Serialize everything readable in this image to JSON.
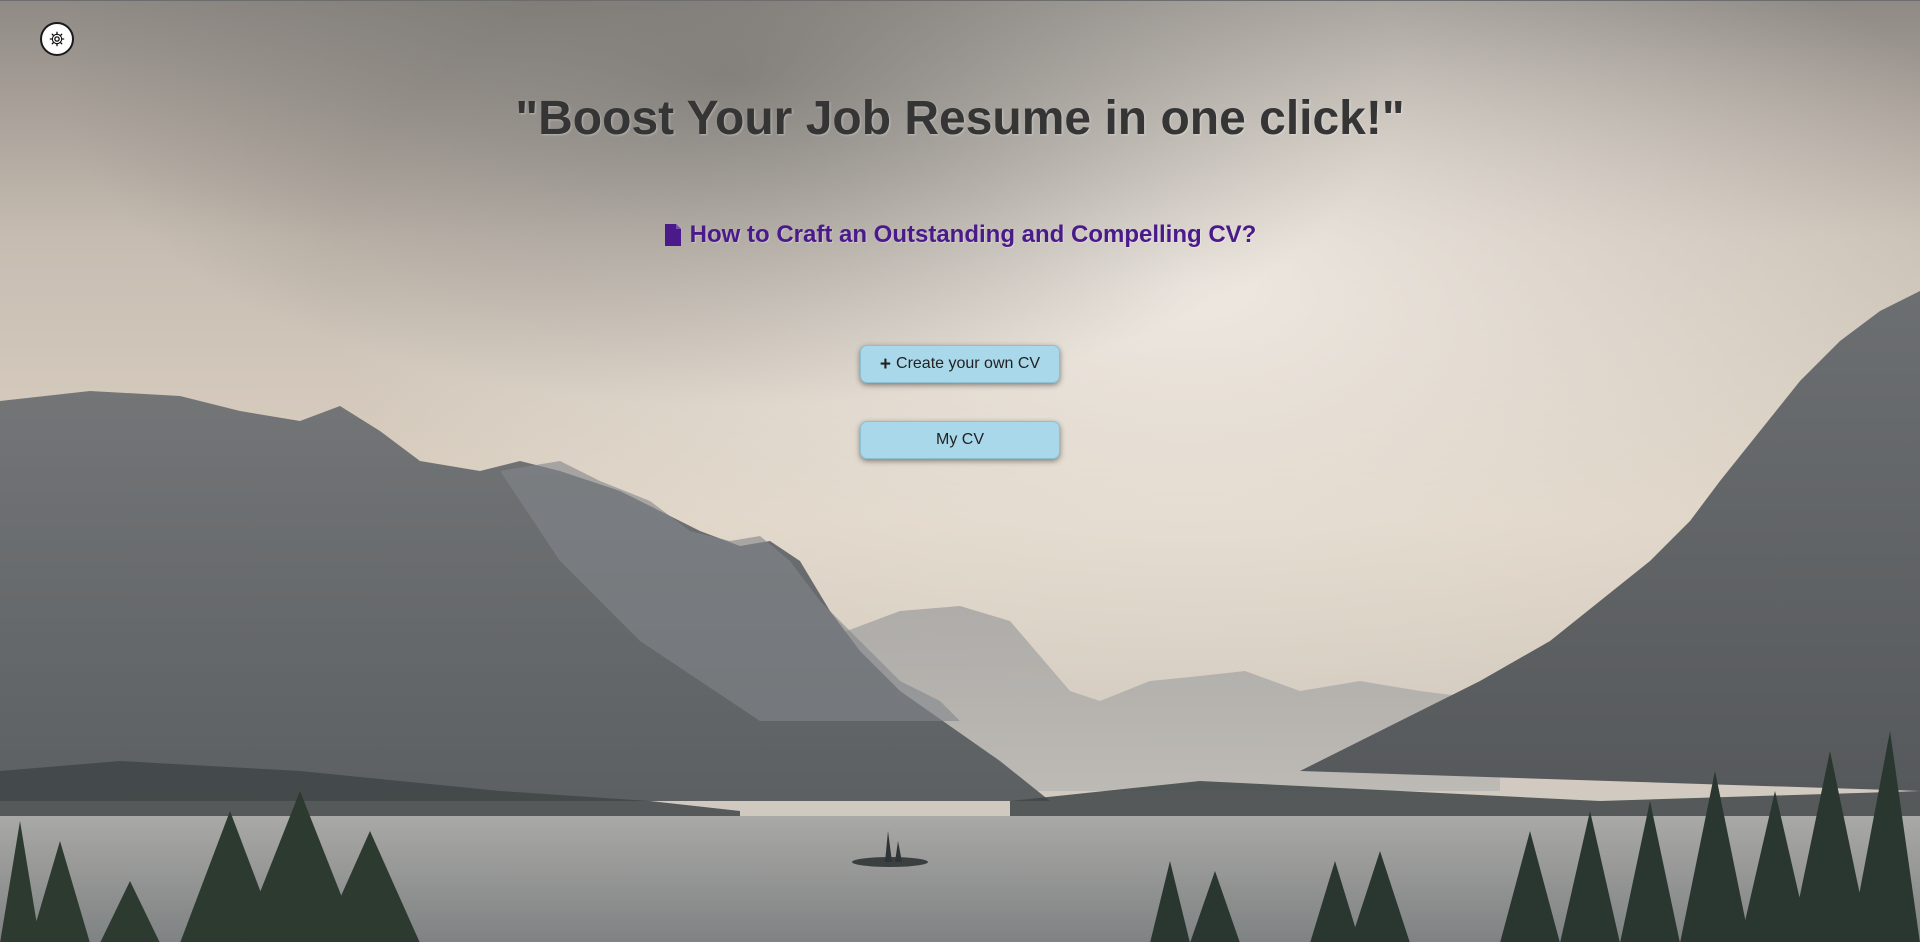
{
  "theme_toggle": {
    "icon": "gear-icon"
  },
  "headline": {
    "text": "\"Boost Your Job Resume in one click!\""
  },
  "guide_link": {
    "icon": "document-icon",
    "text": "How to Craft an Outstanding and Compelling CV?"
  },
  "buttons": {
    "create_cv": {
      "icon": "plus-icon",
      "icon_glyph": "+",
      "label": "Create your own CV"
    },
    "my_cv": {
      "label": "My CV"
    }
  },
  "colors": {
    "headline": "#353535",
    "guide_link": "#4b1a8a",
    "button_bg": "#a9d8ea",
    "button_text": "#222222"
  }
}
